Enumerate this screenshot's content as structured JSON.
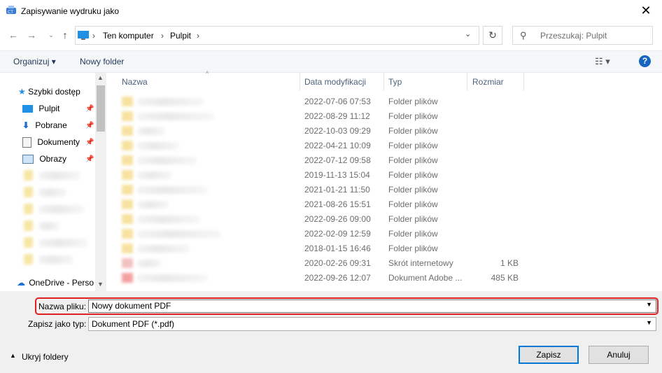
{
  "window": {
    "title": "Zapisywanie wydruku jako",
    "close_icon": "close-icon"
  },
  "nav": {
    "breadcrumb": [
      "Ten komputer",
      "Pulpit"
    ],
    "search_placeholder": "Przeszukaj: Pulpit"
  },
  "toolbar": {
    "organize": "Organizuj ▾",
    "new_folder": "Nowy folder",
    "help": "?"
  },
  "sidebar": {
    "quick_access": "Szybki dostęp",
    "items": [
      {
        "label": "Pulpit",
        "icon": "desktop-icon"
      },
      {
        "label": "Pobrane",
        "icon": "download-icon"
      },
      {
        "label": "Dokumenty",
        "icon": "documents-icon"
      },
      {
        "label": "Obrazy",
        "icon": "pictures-icon"
      }
    ],
    "onedrive": "OneDrive - Perso"
  },
  "columns": {
    "name": "Nazwa",
    "date": "Data modyfikacji",
    "type": "Typ",
    "size": "Rozmiar"
  },
  "files": [
    {
      "date": "2022-07-06 07:53",
      "type": "Folder plików",
      "size": ""
    },
    {
      "date": "2022-08-29 11:12",
      "type": "Folder plików",
      "size": ""
    },
    {
      "date": "2022-10-03 09:29",
      "type": "Folder plików",
      "size": ""
    },
    {
      "date": "2022-04-21 10:09",
      "type": "Folder plików",
      "size": ""
    },
    {
      "date": "2022-07-12 09:58",
      "type": "Folder plików",
      "size": ""
    },
    {
      "date": "2019-11-13 15:04",
      "type": "Folder plików",
      "size": ""
    },
    {
      "date": "2021-01-21 11:50",
      "type": "Folder plików",
      "size": ""
    },
    {
      "date": "2021-08-26 15:51",
      "type": "Folder plików",
      "size": ""
    },
    {
      "date": "2022-09-26 09:00",
      "type": "Folder plików",
      "size": ""
    },
    {
      "date": "2022-02-09 12:59",
      "type": "Folder plików",
      "size": ""
    },
    {
      "date": "2018-01-15 16:46",
      "type": "Folder plików",
      "size": ""
    },
    {
      "date": "2020-02-26 09:31",
      "type": "Skrót internetowy",
      "size": "1 KB"
    },
    {
      "date": "2022-09-26 12:07",
      "type": "Dokument Adobe ...",
      "size": "485 KB"
    }
  ],
  "form": {
    "filename_label": "Nazwa pliku:",
    "filename_value": "Nowy dokument PDF",
    "filetype_label": "Zapisz jako typ:",
    "filetype_value": "Dokument PDF (*.pdf)"
  },
  "footer": {
    "hide_folders": "Ukryj foldery",
    "save": "Zapisz",
    "cancel": "Anuluj"
  },
  "colors": {
    "accent": "#0078d7",
    "highlight": "#e02020",
    "folder": "#f4c542"
  }
}
